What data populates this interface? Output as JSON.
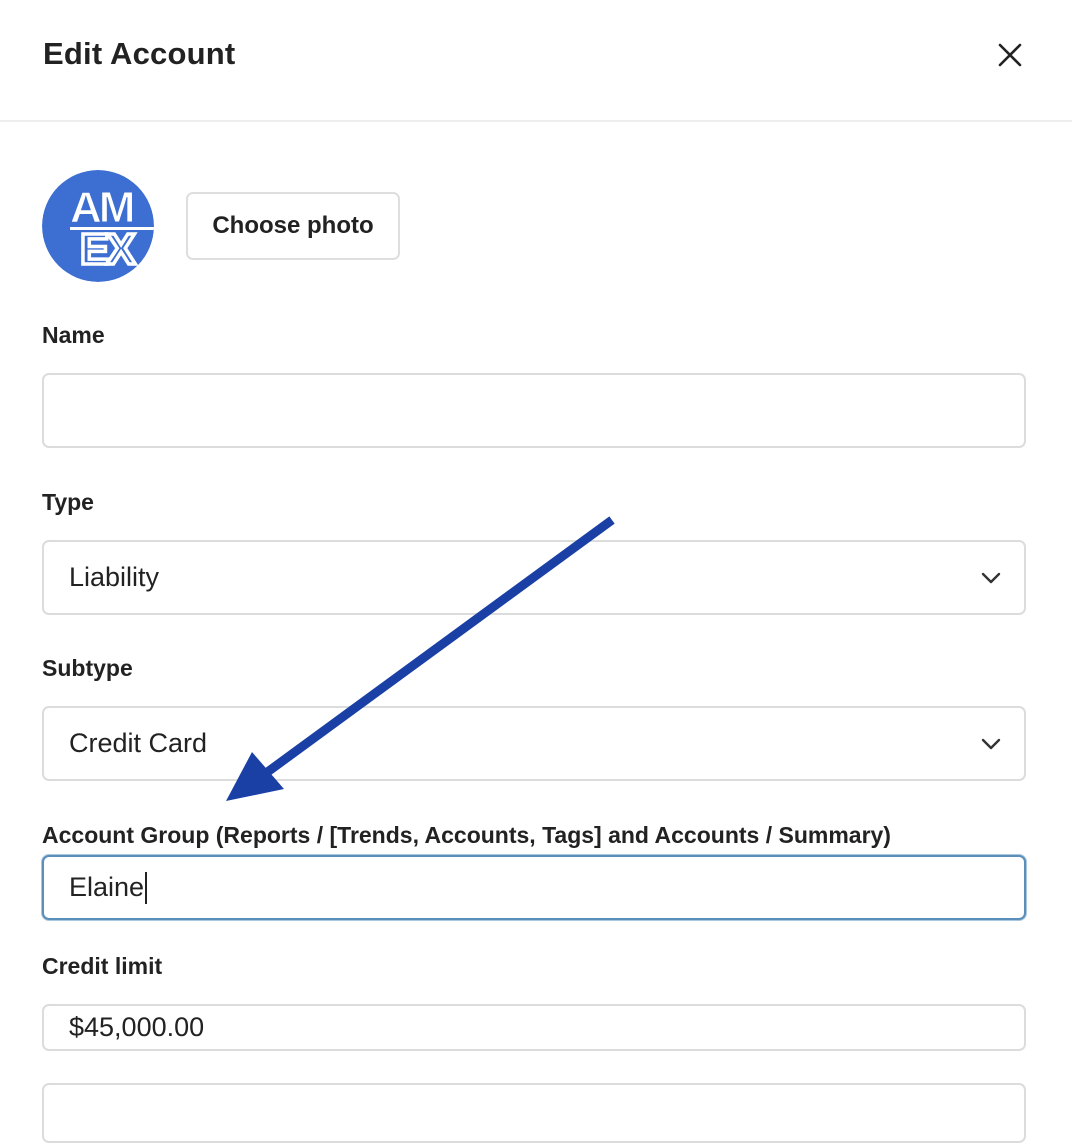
{
  "dialog": {
    "title": "Edit Account",
    "close_icon": "close-icon"
  },
  "photo": {
    "avatar_logo_text_top": "AM",
    "avatar_logo_text_bottom": "EX",
    "avatar_color": "#3c6fd1",
    "choose_photo_label": "Choose photo"
  },
  "form": {
    "name": {
      "label": "Name",
      "value": ""
    },
    "type": {
      "label": "Type",
      "value": "Liability"
    },
    "subtype": {
      "label": "Subtype",
      "value": "Credit Card"
    },
    "account_group": {
      "label": "Account Group (Reports / [Trends, Accounts, Tags] and Accounts / Summary)",
      "value": "Elaine"
    },
    "credit_limit": {
      "label": "Credit limit",
      "value": "$45,000.00"
    }
  },
  "annotation": {
    "arrow_color": "#1a40a6"
  }
}
